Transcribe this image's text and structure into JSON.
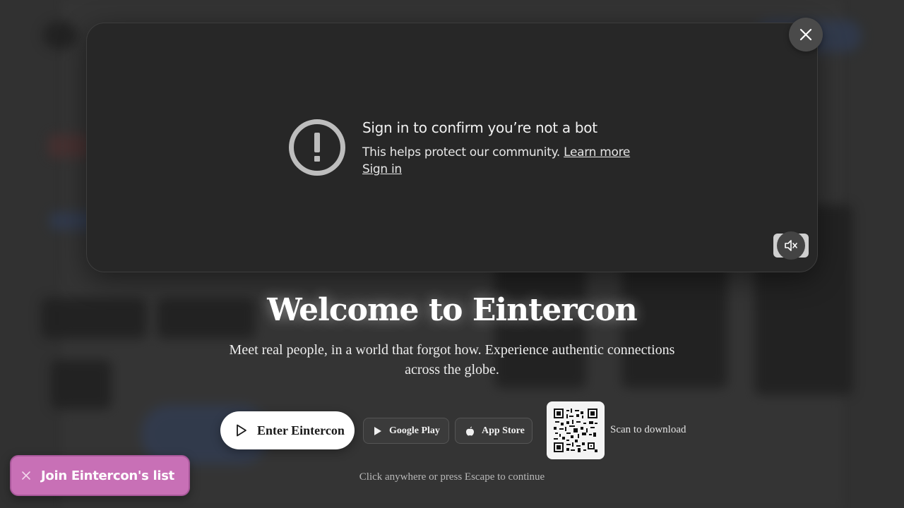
{
  "video": {
    "error_title": "Sign in to confirm you’re not a bot",
    "error_desc": "This helps protect our community.",
    "learn_more": "Learn more",
    "sign_in": "Sign in",
    "warning_icon": "exclamation-circle-icon",
    "mute_icon": "volume-muted-icon"
  },
  "close_icon": "close-icon",
  "welcome": {
    "title": "Welcome to Eintercon",
    "subtitle": "Meet real people, in a world that forgot how. Experience authentic connections across the globe."
  },
  "actions": {
    "enter_label": "Enter Eintercon",
    "google_play_label": "Google Play",
    "app_store_label": "App Store",
    "qr_label": "Scan to download"
  },
  "hint": "Click anywhere or press Escape to continue",
  "join": {
    "label": "Join Eintercon's list"
  },
  "colors": {
    "join_bg": "#c870b6",
    "panel_bg": "#272727",
    "enter_bg": "#ffffff"
  }
}
